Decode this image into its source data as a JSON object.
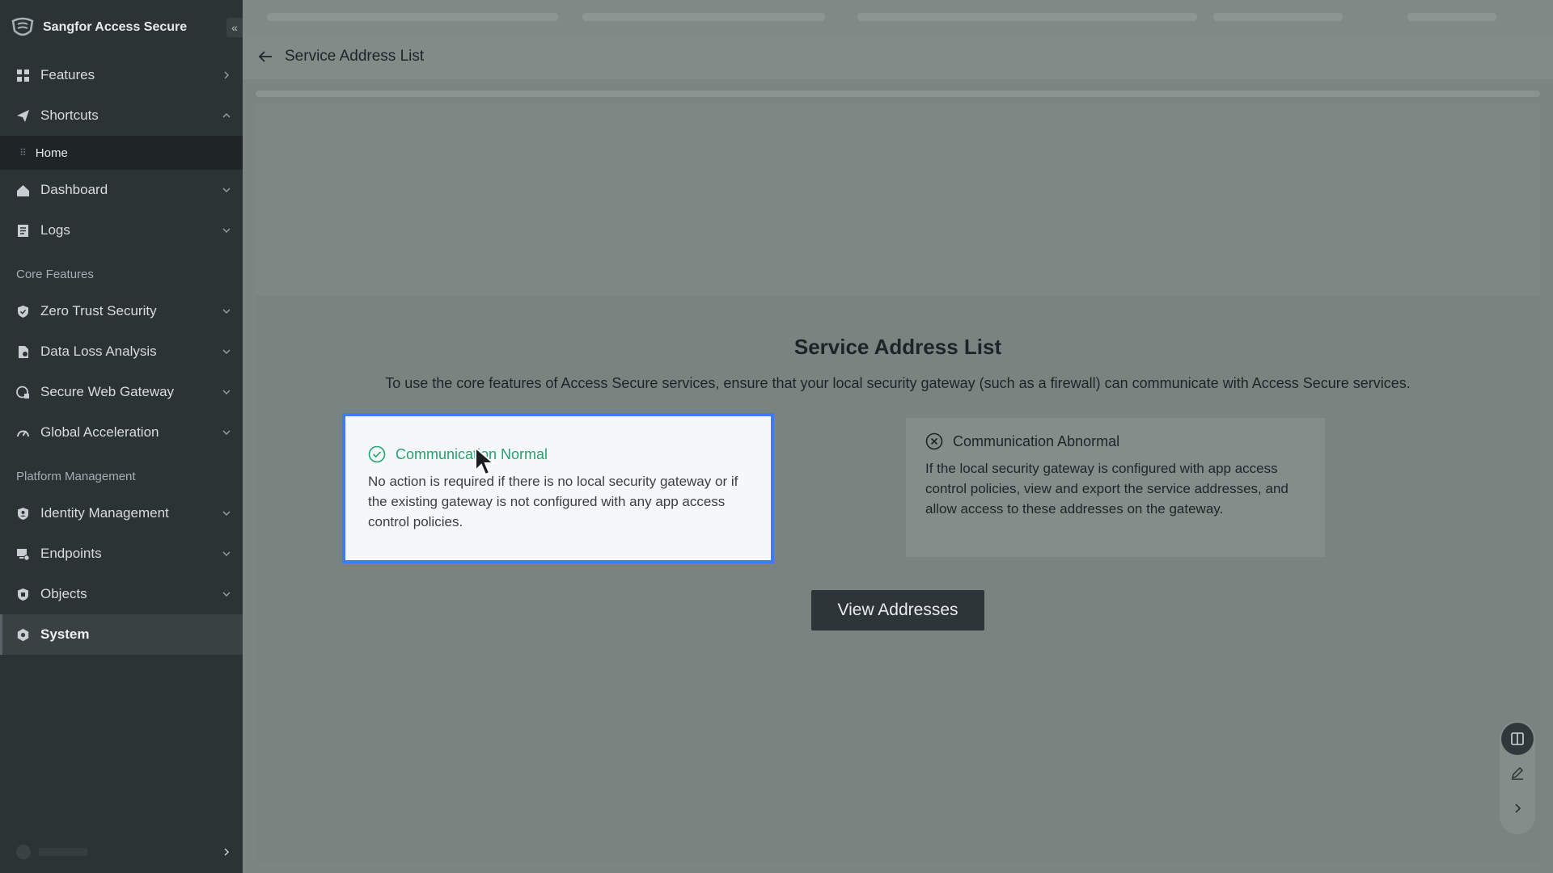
{
  "app": {
    "name": "Sangfor Access Secure"
  },
  "sidebar": {
    "collapse_glyph": "«",
    "items": [
      {
        "key": "features",
        "label": "Features",
        "icon": "grid-icon",
        "chevron": "right"
      },
      {
        "key": "shortcuts",
        "label": "Shortcuts",
        "icon": "paper-plane-icon",
        "chevron": "up"
      }
    ],
    "shortcut_sub": {
      "label": "Home",
      "drag_glyph": "⠿"
    },
    "items_after": [
      {
        "key": "dashboard",
        "label": "Dashboard",
        "icon": "dashboard-icon"
      },
      {
        "key": "logs",
        "label": "Logs",
        "icon": "logs-icon"
      }
    ],
    "section_core": "Core Features",
    "core_items": [
      {
        "key": "zero-trust-security",
        "label": "Zero Trust Security",
        "icon": "shield-icon"
      },
      {
        "key": "data-loss-analysis",
        "label": "Data Loss Analysis",
        "icon": "document-icon"
      },
      {
        "key": "secure-web-gateway",
        "label": "Secure Web Gateway",
        "icon": "globe-lock-icon"
      },
      {
        "key": "global-acceleration",
        "label": "Global Acceleration",
        "icon": "speed-icon"
      }
    ],
    "section_platform": "Platform Management",
    "platform_items": [
      {
        "key": "identity-management",
        "label": "Identity Management",
        "icon": "id-icon"
      },
      {
        "key": "endpoints",
        "label": "Endpoints",
        "icon": "endpoint-icon"
      },
      {
        "key": "objects",
        "label": "Objects",
        "icon": "objects-icon"
      },
      {
        "key": "system",
        "label": "System",
        "icon": "gear-icon",
        "active": true
      }
    ]
  },
  "header": {
    "title": "Service Address List"
  },
  "main": {
    "title": "Service Address List",
    "description": "To use the core features of Access Secure services, ensure that your local security gateway (such as a firewall) can communicate with Access Secure services.",
    "card_normal": {
      "title": "Communication Normal",
      "body": "No action is required if there is no local security gateway or if the existing gateway is not configured with any app access control policies."
    },
    "card_abnormal": {
      "title": "Communication Abnormal",
      "body": "If the local security gateway is configured with app access control policies, view and export the service addresses, and allow access to these addresses on the gateway."
    },
    "view_button": "View Addresses"
  },
  "colors": {
    "accent_green": "#26a36a",
    "selection_blue": "#3d7cf4",
    "sidebar_bg": "#2c3335"
  }
}
